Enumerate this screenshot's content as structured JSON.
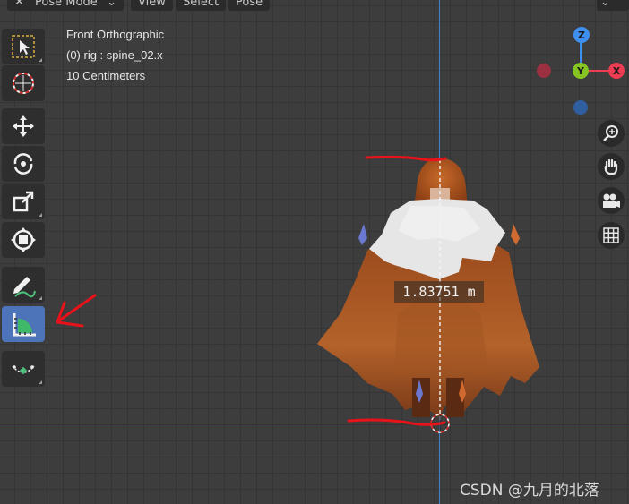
{
  "header": {
    "mode": "Pose Mode",
    "menus": [
      "View",
      "Select",
      "Pose"
    ]
  },
  "overlay": {
    "view_name": "Front Orthographic",
    "object_info": "(0) rig : spine_02.x",
    "grid_scale": "10 Centimeters"
  },
  "toolbar": {
    "tools": [
      {
        "name": "select-box",
        "active": false
      },
      {
        "name": "cursor",
        "active": false
      },
      {
        "name": "move",
        "active": false
      },
      {
        "name": "rotate",
        "active": false
      },
      {
        "name": "scale",
        "active": false
      },
      {
        "name": "transform",
        "active": false
      },
      {
        "name": "annotate",
        "active": false
      },
      {
        "name": "measure",
        "active": true
      },
      {
        "name": "bone-size",
        "active": false
      }
    ]
  },
  "gizmo": {
    "x_label": "X",
    "y_label": "Y",
    "z_label": "Z",
    "colors": {
      "x": "#ee3c52",
      "y": "#86c521",
      "z": "#3d8ff0",
      "neg_x": "#9a3040",
      "neg_z": "#2f5fa0"
    }
  },
  "navigation": [
    "zoom-icon",
    "hand-icon",
    "camera-icon",
    "grid-icon"
  ],
  "measurement": {
    "value": "1.83751 m"
  },
  "watermark": "CSDN @九月的北落",
  "colors": {
    "viewport_bg": "#3d3d3d",
    "active_tool": "#4d74b8",
    "annotation_red": "#e8121a"
  }
}
